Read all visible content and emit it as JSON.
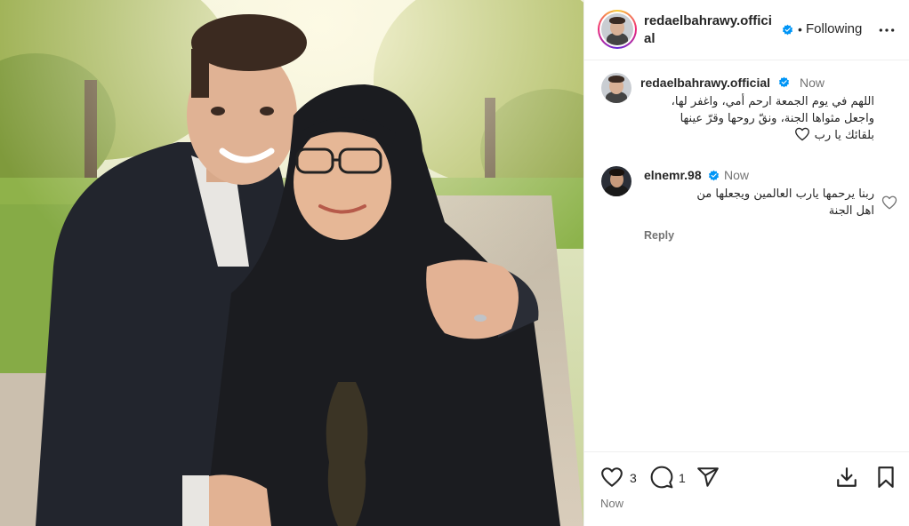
{
  "post": {
    "username": "redaelbahrawy.official",
    "follow_status": "Following",
    "dot": "•"
  },
  "caption": {
    "username": "redaelbahrawy.official",
    "time": "Now",
    "lines": [
      "اللهم في يوم الجمعة ارحم أمي، واغفر لها،",
      "واجعل مثواها الجنة، ونقّ روحها وقرّ عينها",
      "بلقائك يا رب"
    ]
  },
  "comment": {
    "username": "elnemr.98",
    "time": "Now",
    "lines": [
      "ربنا يرحمها يارب العالمين ويجعلها من",
      "اهل الجنة"
    ],
    "reply_label": "Reply"
  },
  "actions": {
    "likes_count": "3",
    "comments_count": "1",
    "timestamp": "Now"
  },
  "icons": {
    "verified": "verified-badge-icon",
    "more": "more-options-icon",
    "like": "heart-icon",
    "comment": "comment-bubble-icon",
    "share": "share-send-icon",
    "download": "download-icon",
    "save": "bookmark-icon"
  },
  "colors": {
    "verified_blue": "#0095f6",
    "muted_text": "#737373",
    "text": "#262626",
    "divider": "#efefef"
  }
}
